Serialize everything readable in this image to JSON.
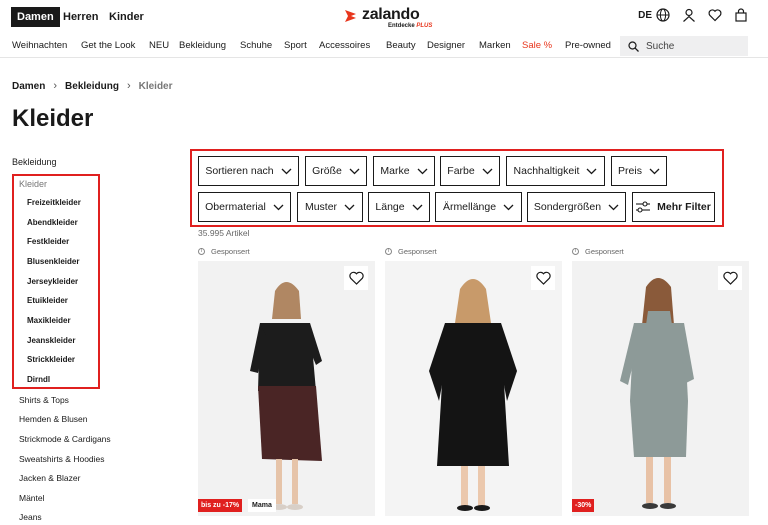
{
  "header": {
    "genders": [
      "Damen",
      "Herren",
      "Kinder"
    ],
    "logo": {
      "name": "zalando",
      "sub": "Entdecke",
      "plus": "PLUS"
    },
    "lang": "DE"
  },
  "nav": {
    "items": [
      "Weihnachten",
      "Get the Look",
      "NEU",
      "Bekleidung",
      "Schuhe",
      "Sport",
      "Accessoires",
      "Beauty",
      "Designer",
      "Marken",
      "Sale %",
      "Pre-owned"
    ],
    "search_label": "Suche"
  },
  "breadcrumb": [
    "Damen",
    "Bekleidung",
    "Kleider"
  ],
  "page_title": "Kleider",
  "sidebar": {
    "root": "Bekleidung",
    "active": "Kleider",
    "sub_items": [
      "Freizeitkleider",
      "Abendkleider",
      "Festkleider",
      "Blusenkleider",
      "Jerseykleider",
      "Etuikleider",
      "Maxikleider",
      "Jeanskleider",
      "Strickkleider",
      "Dirndl"
    ],
    "items": [
      "Shirts & Tops",
      "Hemden & Blusen",
      "Strickmode & Cardigans",
      "Sweatshirts & Hoodies",
      "Jacken & Blazer",
      "Mäntel",
      "Jeans"
    ]
  },
  "filters": {
    "row1": [
      "Sortieren nach",
      "Größe",
      "Marke",
      "Farbe",
      "Nachhaltigkeit",
      "Preis"
    ],
    "row2": [
      "Obermaterial",
      "Muster",
      "Länge",
      "Ärmellänge",
      "Sondergrößen"
    ],
    "more": "Mehr Filter"
  },
  "article_count": "35.995 Artikel",
  "products": [
    {
      "sponsored": "Gesponsert",
      "sale_badge": "bis zu -17%",
      "tag": "Mama"
    },
    {
      "sponsored": "Gesponsert"
    },
    {
      "sponsored": "Gesponsert",
      "sale_badge": "-30%"
    }
  ],
  "colors": {
    "accent": "#e8361d",
    "highlight": "#e0201f",
    "text": "#1a1a1a"
  }
}
